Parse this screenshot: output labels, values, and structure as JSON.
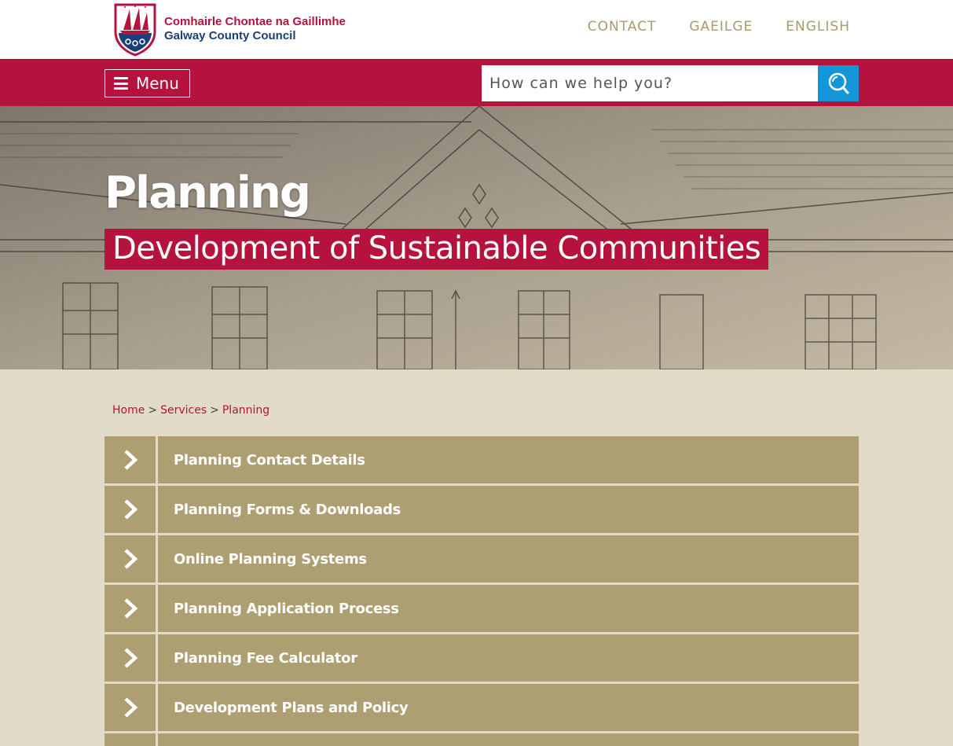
{
  "header": {
    "logo_irish": "Comhairle Chontae na Gaillimhe",
    "logo_english": "Galway County Council",
    "links": [
      {
        "label": "CONTACT"
      },
      {
        "label": "GAEILGE"
      },
      {
        "label": "ENGLISH"
      }
    ]
  },
  "nav": {
    "menu_label": "Menu",
    "search_placeholder": "How can we help you?",
    "search_icon": "search-icon"
  },
  "hero": {
    "title": "Planning",
    "subtitle": "Development of Sustainable Communities"
  },
  "breadcrumb": {
    "items": [
      "Home",
      "Services",
      "Planning"
    ],
    "separator": ">"
  },
  "links": [
    {
      "label": "Planning Contact Details"
    },
    {
      "label": "Planning Forms & Downloads"
    },
    {
      "label": "Online Planning Systems"
    },
    {
      "label": "Planning Application Process"
    },
    {
      "label": "Planning Fee Calculator"
    },
    {
      "label": "Development Plans and Policy"
    },
    {
      "label": ""
    }
  ],
  "colors": {
    "brand_red": "#b5123e",
    "brand_blue": "#1c3f7a",
    "search_blue": "#1495d8",
    "tan": "#ae9f72",
    "page_bg": "#e2dbc7",
    "top_link": "#a89b6f"
  }
}
